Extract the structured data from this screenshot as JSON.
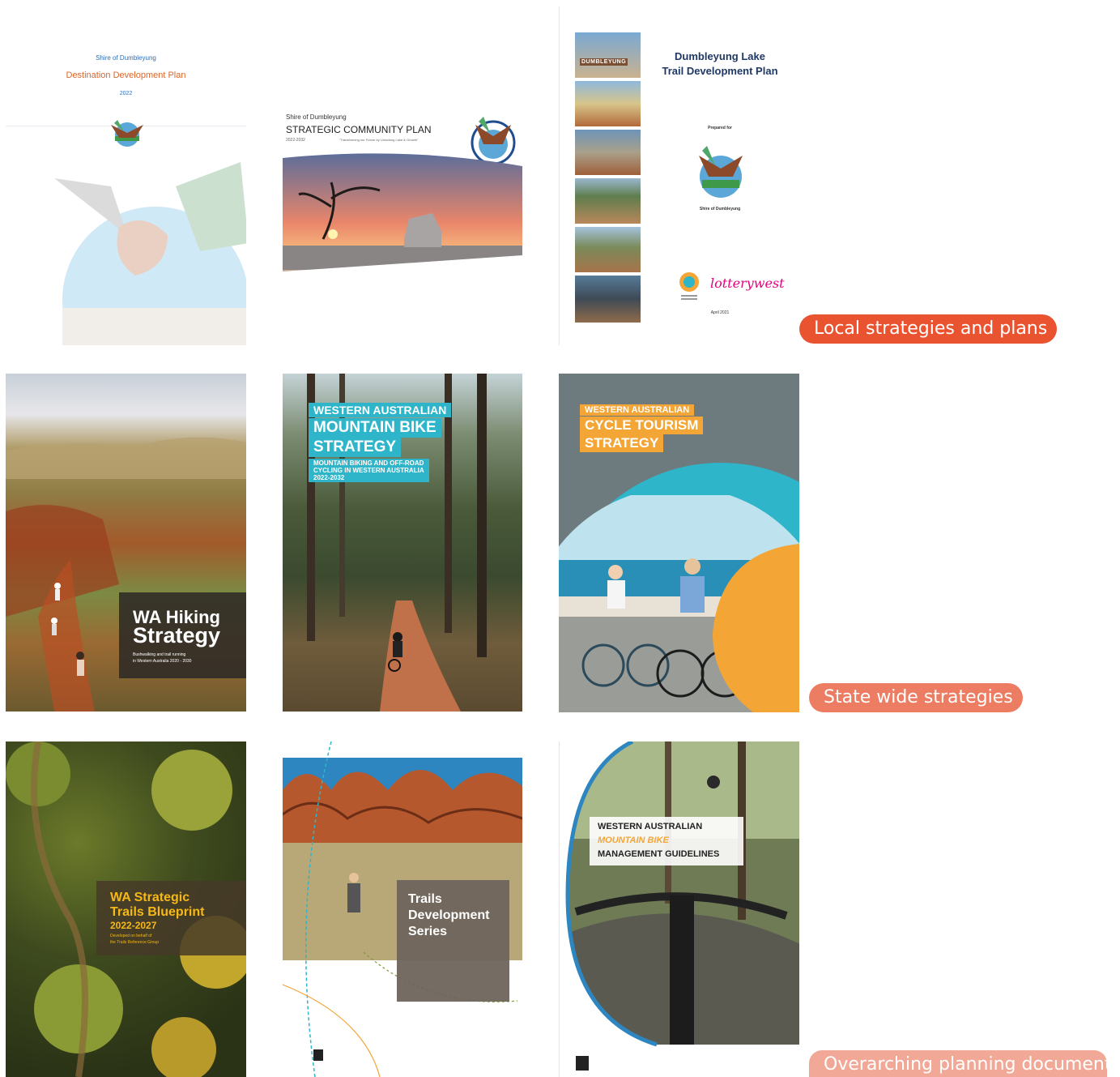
{
  "colors": {
    "pill_local": "#EA5330",
    "pill_state": "#ED7D62",
    "pill_overarching": "#F2A896",
    "mtb_teal": "#2EB5C9",
    "cycle_orange": "#F3A536",
    "blueprint_gold": "#F6B817"
  },
  "row_labels": {
    "local": "Local strategies and plans",
    "state": "State wide strategies",
    "overarching": "Overarching planning documents"
  },
  "doc_destination": {
    "shire": "Shire of Dumbleyung",
    "title": "Destination Development Plan",
    "year": "2022"
  },
  "doc_community": {
    "shire": "Shire of Dumbleyung",
    "title": "STRATEGIC COMMUNITY PLAN",
    "years": "2022-2032",
    "tagline": "\"Transforming our Future by Unlocking Lake & Growth\""
  },
  "doc_lake": {
    "title_line1": "Dumbleyung Lake",
    "title_line2": "Trail Development Plan",
    "prepared_for": "Prepared for",
    "shire": "Shire of Dumbleyung",
    "sign": "DUMBLEYUNG",
    "sponsor": "lotterywest",
    "date": "April 2021"
  },
  "doc_hiking": {
    "title_line1": "WA Hiking",
    "title_line2": "Strategy",
    "subtitle_line1": "Bushwalking and trail running",
    "subtitle_line2": "in Western Australia 2020 - 2030"
  },
  "doc_mtb": {
    "line1": "WESTERN AUSTRALIAN",
    "line2": "MOUNTAIN BIKE",
    "line3": "STRATEGY",
    "sub1": "MOUNTAIN BIKING AND OFF-ROAD",
    "sub2": "CYCLING IN WESTERN AUSTRALIA",
    "sub3": "2022-2032"
  },
  "doc_cycle": {
    "line1": "WESTERN AUSTRALIAN",
    "line2": "CYCLE TOURISM",
    "line3": "STRATEGY"
  },
  "doc_blueprint": {
    "line1": "WA Strategic",
    "line2": "Trails Blueprint",
    "line3": "2022-2027",
    "sub1": "Developed on behalf of",
    "sub2": "the Trails Reference Group"
  },
  "doc_trails_series": {
    "line1": "Trails",
    "line2": "Development",
    "line3": "Series"
  },
  "doc_mtb_guidelines": {
    "line1": "WESTERN AUSTRALIAN",
    "line2": "MOUNTAIN BIKE",
    "line3": "MANAGEMENT GUIDELINES"
  }
}
